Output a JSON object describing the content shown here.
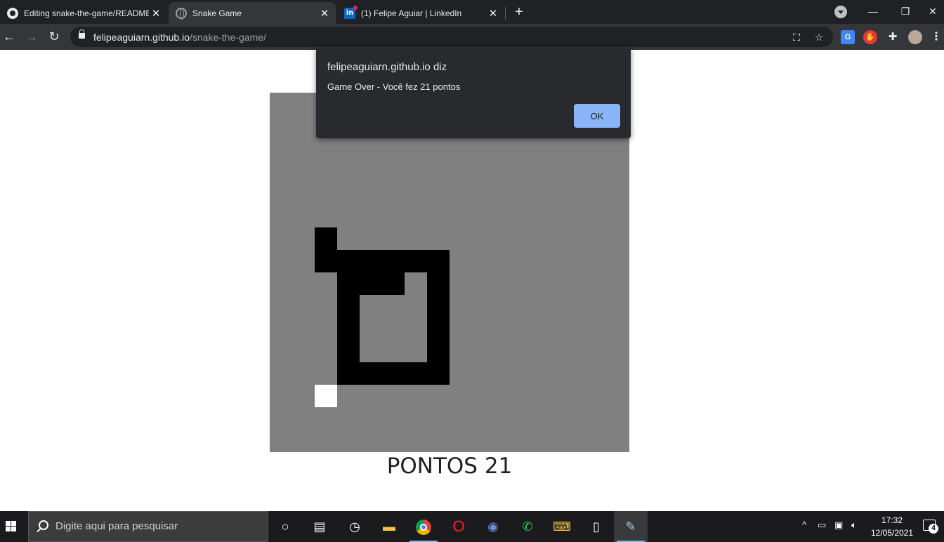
{
  "browser": {
    "tabs": [
      {
        "title": "Editing snake-the-game/README",
        "favicon": "github-icon",
        "active": false
      },
      {
        "title": "Snake Game",
        "favicon": "globe-icon",
        "active": true
      },
      {
        "title": "(1) Felipe Aguiar | LinkedIn",
        "favicon": "linkedin-icon",
        "active": false
      }
    ],
    "tab_close": "✕",
    "new_tab": "+",
    "window_controls": {
      "minimize": "—",
      "restore": "❐",
      "close": "✕"
    },
    "nav": {
      "back": "←",
      "forward": "→",
      "reload": "↻"
    },
    "address": {
      "host": "felipeaguiarn.github.io",
      "path": "/snake-the-game/"
    },
    "omnibox_icons": {
      "translate": "⛶",
      "bookmark": "☆"
    },
    "extensions": [
      "google-translate-icon",
      "adblock-icon",
      "puzzle-extensions-icon",
      "profile-avatar-icon"
    ],
    "menu": "⋮"
  },
  "alert": {
    "origin": "felipeaguiarn.github.io diz",
    "message": "Game Over - Você fez 21 pontos",
    "ok_label": "OK"
  },
  "game": {
    "score_text": "PONTOS 21",
    "score": 21,
    "board_color": "#808080",
    "snake_color": "#000000",
    "food_color": "#ffffff"
  },
  "taskbar": {
    "search_placeholder": "Digite aqui para pesquisar",
    "apps": [
      "cortana-icon",
      "task-view-icon",
      "clock-app-icon",
      "file-explorer-icon",
      "chrome-icon",
      "opera-icon",
      "discord-icon",
      "whatsapp-icon",
      "keyboard-app-icon",
      "notepad-icon",
      "paint-icon"
    ],
    "tray_chevron": "^",
    "time": "17:32",
    "date": "12/05/2021",
    "notification_count": "4"
  }
}
